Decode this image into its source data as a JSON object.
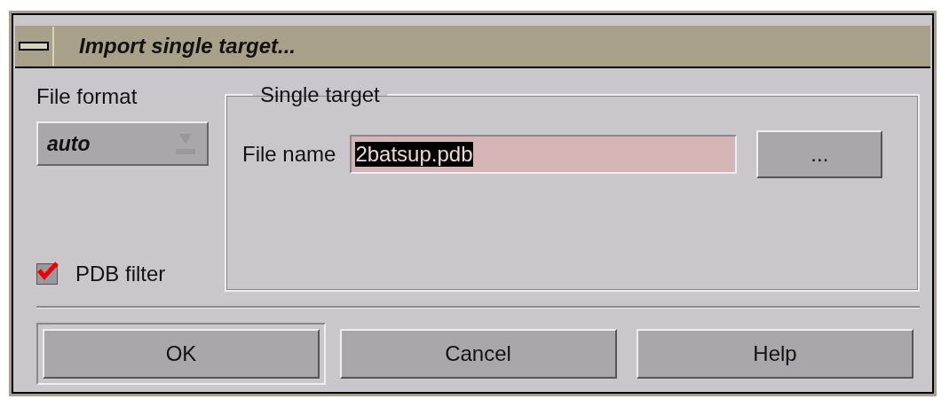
{
  "window": {
    "title": "Import single target..."
  },
  "file_format": {
    "label": "File format",
    "value": "auto"
  },
  "pdb_filter": {
    "label": "PDB filter",
    "checked": true
  },
  "single_target": {
    "title": "Single target",
    "file_name": {
      "label": "File name",
      "value": "2batsup.pdb",
      "text_selected": true
    },
    "browse_button": "..."
  },
  "buttons": [
    {
      "label": "OK",
      "default": true
    },
    {
      "label": "Cancel",
      "default": false
    },
    {
      "label": "Help",
      "default": false
    }
  ]
}
